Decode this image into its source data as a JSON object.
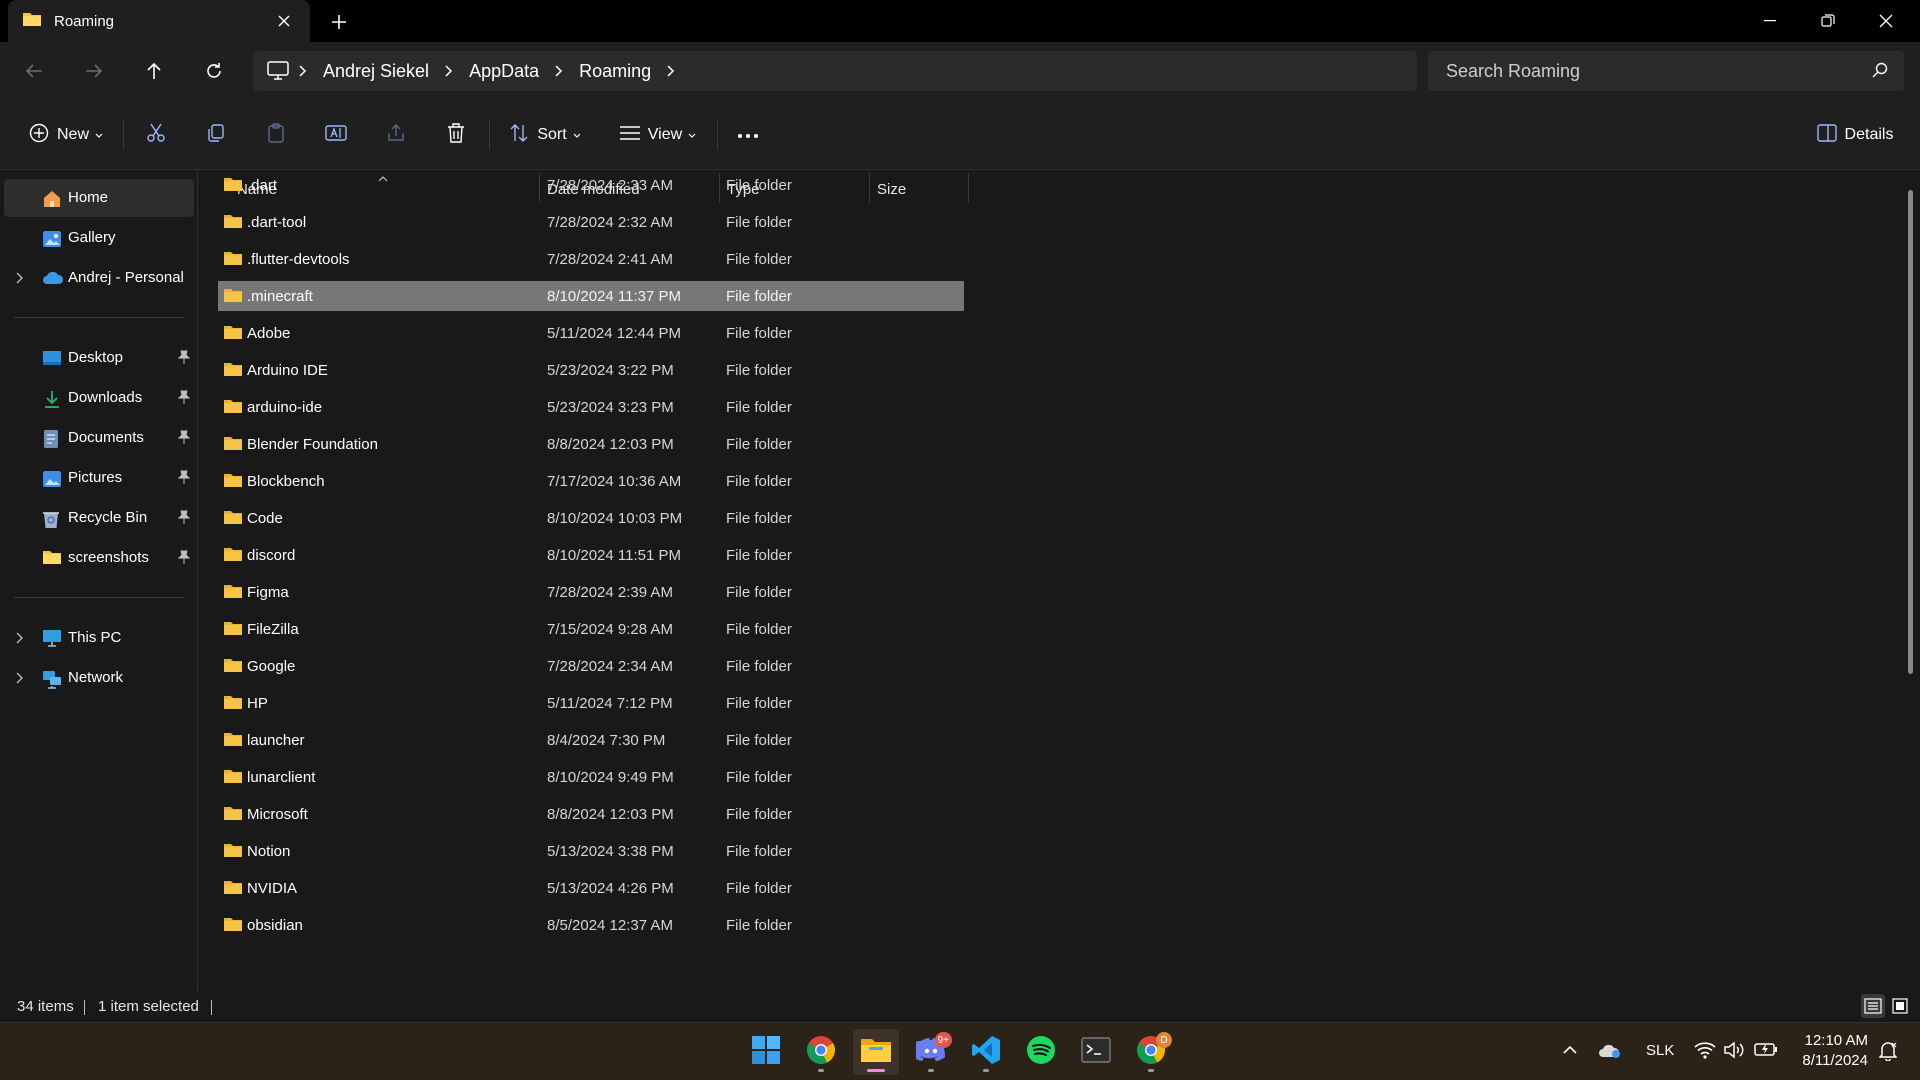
{
  "window": {
    "tab_title": "Roaming",
    "new_tab_symbol": "+"
  },
  "address": {
    "crumbs": [
      "Andrej Siekel",
      "AppData",
      "Roaming"
    ],
    "search_placeholder": "Search Roaming"
  },
  "toolbar": {
    "new_label": "New",
    "sort_label": "Sort",
    "view_label": "View",
    "details_label": "Details"
  },
  "sidebar": {
    "home": "Home",
    "gallery": "Gallery",
    "onedrive": "Andrej - Personal",
    "desktop": "Desktop",
    "downloads": "Downloads",
    "documents": "Documents",
    "pictures": "Pictures",
    "recycle_bin": "Recycle Bin",
    "screenshots": "screenshots",
    "this_pc": "This PC",
    "network": "Network"
  },
  "columns": {
    "name": "Name",
    "date": "Date modified",
    "type": "Type",
    "size": "Size"
  },
  "files": [
    {
      "name": ".dart",
      "date": "7/28/2024 2:33 AM",
      "type": "File folder"
    },
    {
      "name": ".dart-tool",
      "date": "7/28/2024 2:32 AM",
      "type": "File folder"
    },
    {
      "name": ".flutter-devtools",
      "date": "7/28/2024 2:41 AM",
      "type": "File folder"
    },
    {
      "name": ".minecraft",
      "date": "8/10/2024 11:37 PM",
      "type": "File folder",
      "selected": true
    },
    {
      "name": "Adobe",
      "date": "5/11/2024 12:44 PM",
      "type": "File folder"
    },
    {
      "name": "Arduino IDE",
      "date": "5/23/2024 3:22 PM",
      "type": "File folder"
    },
    {
      "name": "arduino-ide",
      "date": "5/23/2024 3:23 PM",
      "type": "File folder"
    },
    {
      "name": "Blender Foundation",
      "date": "8/8/2024 12:03 PM",
      "type": "File folder"
    },
    {
      "name": "Blockbench",
      "date": "7/17/2024 10:36 AM",
      "type": "File folder"
    },
    {
      "name": "Code",
      "date": "8/10/2024 10:03 PM",
      "type": "File folder"
    },
    {
      "name": "discord",
      "date": "8/10/2024 11:51 PM",
      "type": "File folder"
    },
    {
      "name": "Figma",
      "date": "7/28/2024 2:39 AM",
      "type": "File folder"
    },
    {
      "name": "FileZilla",
      "date": "7/15/2024 9:28 AM",
      "type": "File folder"
    },
    {
      "name": "Google",
      "date": "7/28/2024 2:34 AM",
      "type": "File folder"
    },
    {
      "name": "HP",
      "date": "5/11/2024 7:12 PM",
      "type": "File folder"
    },
    {
      "name": "launcher",
      "date": "8/4/2024 7:30 PM",
      "type": "File folder"
    },
    {
      "name": "lunarclient",
      "date": "8/10/2024 9:49 PM",
      "type": "File folder"
    },
    {
      "name": "Microsoft",
      "date": "8/8/2024 12:03 PM",
      "type": "File folder"
    },
    {
      "name": "Notion",
      "date": "5/13/2024 3:38 PM",
      "type": "File folder"
    },
    {
      "name": "NVIDIA",
      "date": "5/13/2024 4:26 PM",
      "type": "File folder"
    },
    {
      "name": "obsidian",
      "date": "8/5/2024 12:37 AM",
      "type": "File folder"
    }
  ],
  "status": {
    "item_count": "34 items",
    "selection": "1 item selected"
  },
  "taskbar": {
    "discord_badge": "9+",
    "chrome_badge": "D",
    "language": "SLK",
    "time": "12:10 AM",
    "date": "8/11/2024"
  },
  "colors": {
    "folder": "#f6c445",
    "selected_row": "#777777",
    "taskbar": "#2b2218"
  }
}
